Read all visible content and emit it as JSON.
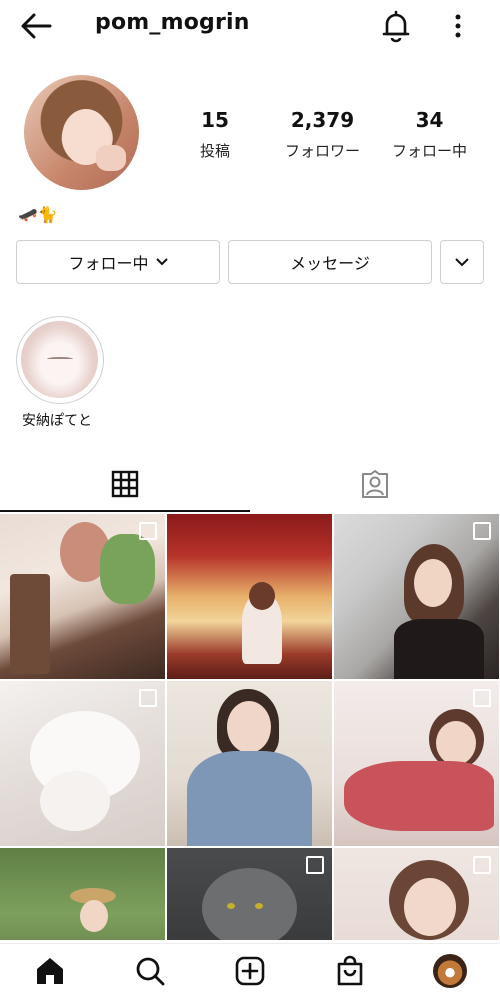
{
  "header": {
    "username": "pom_mogrin",
    "back_icon": "arrow-left-icon",
    "bell_icon": "bell-icon",
    "more_icon": "more-vertical-icon"
  },
  "profile": {
    "stats": [
      {
        "value": "15",
        "label": "投稿"
      },
      {
        "value": "2,379",
        "label": "フォロワー"
      },
      {
        "value": "34",
        "label": "フォロー中"
      }
    ],
    "bio": "🛹🐈"
  },
  "actions": {
    "following_label": "フォロー中",
    "message_label": "メッセージ",
    "expand_icon": "chevron-down-icon"
  },
  "highlights": [
    {
      "label": "安納ぽてと"
    }
  ],
  "tabs": [
    {
      "icon": "grid-icon",
      "active": true
    },
    {
      "icon": "tagged-person-icon",
      "active": false
    }
  ],
  "posts": [
    {
      "multiple": true
    },
    {
      "multiple": false
    },
    {
      "multiple": true
    },
    {
      "multiple": true
    },
    {
      "multiple": false
    },
    {
      "multiple": true
    },
    {
      "multiple": false
    },
    {
      "multiple": true
    },
    {
      "multiple": true
    }
  ],
  "bottom_nav": [
    "home-icon",
    "search-icon",
    "create-icon",
    "shop-icon",
    "profile-avatar"
  ]
}
